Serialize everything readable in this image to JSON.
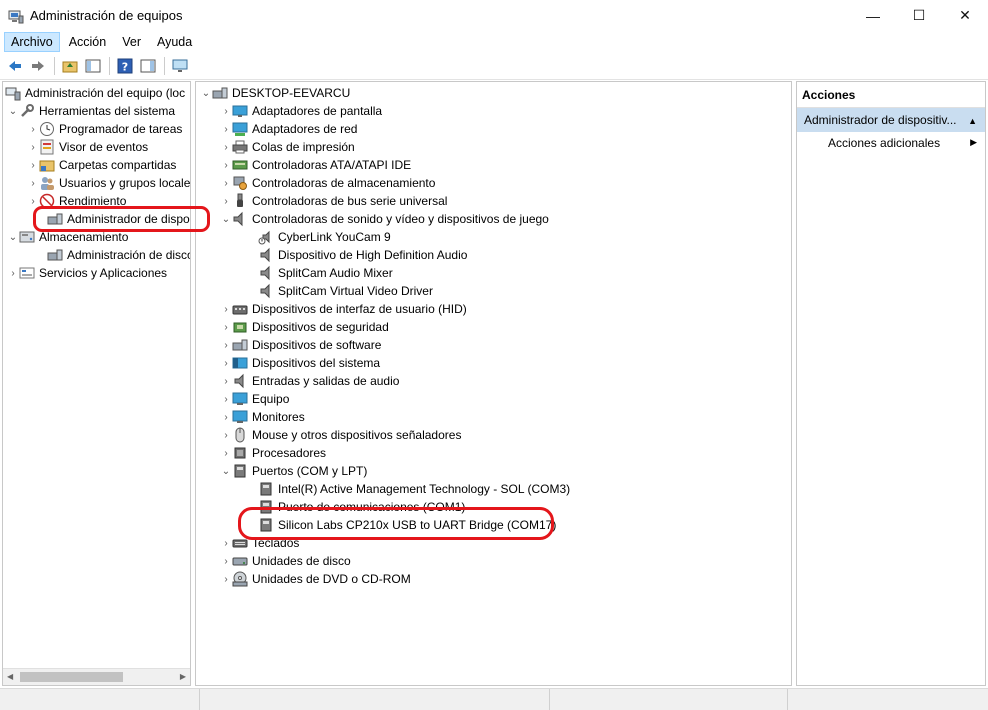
{
  "window": {
    "title": "Administración de equipos",
    "minimize_glyph": "—",
    "maximize_glyph": "☐",
    "close_glyph": "✕"
  },
  "menu": [
    "Archivo",
    "Acción",
    "Ver",
    "Ayuda"
  ],
  "toolbar": {
    "icons": [
      "back-icon",
      "forward-icon",
      "up-folder-icon",
      "show-hide-tree-icon",
      "help-icon",
      "show-hide-action-pane-icon",
      "computer-view-icon"
    ]
  },
  "left_tree": {
    "root": "Administración del equipo (loc",
    "tools": "Herramientas del sistema",
    "scheduler": "Programador de tareas",
    "event_viewer": "Visor de eventos",
    "shared_folders": "Carpetas compartidas",
    "users_groups": "Usuarios y grupos locale",
    "performance": "Rendimiento",
    "device_manager": "Administrador de dispo",
    "storage": "Almacenamiento",
    "disk_management": "Administración de disco",
    "services": "Servicios y Aplicaciones"
  },
  "device_tree": {
    "root": "DESKTOP-EEVARCU",
    "display_adapters": "Adaptadores de pantalla",
    "network_adapters": "Adaptadores de red",
    "print_queues": "Colas de impresión",
    "ata": "Controladoras ATA/ATAPI IDE",
    "storage_ctrl": "Controladoras de almacenamiento",
    "usb": "Controladoras de bus serie universal",
    "sound": "Controladoras de sonido y vídeo y dispositivos de juego",
    "sound_children": [
      "CyberLink YouCam 9",
      "Dispositivo de High Definition Audio",
      "SplitCam Audio Mixer",
      "SplitCam Virtual Video Driver"
    ],
    "hid": "Dispositivos de interfaz de usuario (HID)",
    "security": "Dispositivos de seguridad",
    "software": "Dispositivos de software",
    "system": "Dispositivos del sistema",
    "audio_io": "Entradas y salidas de audio",
    "computer": "Equipo",
    "monitors": "Monitores",
    "mice": "Mouse y otros dispositivos señaladores",
    "processors": "Procesadores",
    "ports": "Puertos (COM y LPT)",
    "ports_children": [
      "Intel(R) Active Management Technology - SOL (COM3)",
      "Puerto de comunicaciones (COM1)",
      "Silicon Labs CP210x USB to UART Bridge (COM17)"
    ],
    "keyboards": "Teclados",
    "disk_drives": "Unidades de disco",
    "dvd": "Unidades de DVD o CD-ROM"
  },
  "actions": {
    "header": "Acciones",
    "section": "Administrador de dispositiv...",
    "more": "Acciones adicionales"
  },
  "colors": {
    "selection": "#c9ddf0",
    "annotation": "#e4161b",
    "menu_active": "#cce8ff"
  }
}
